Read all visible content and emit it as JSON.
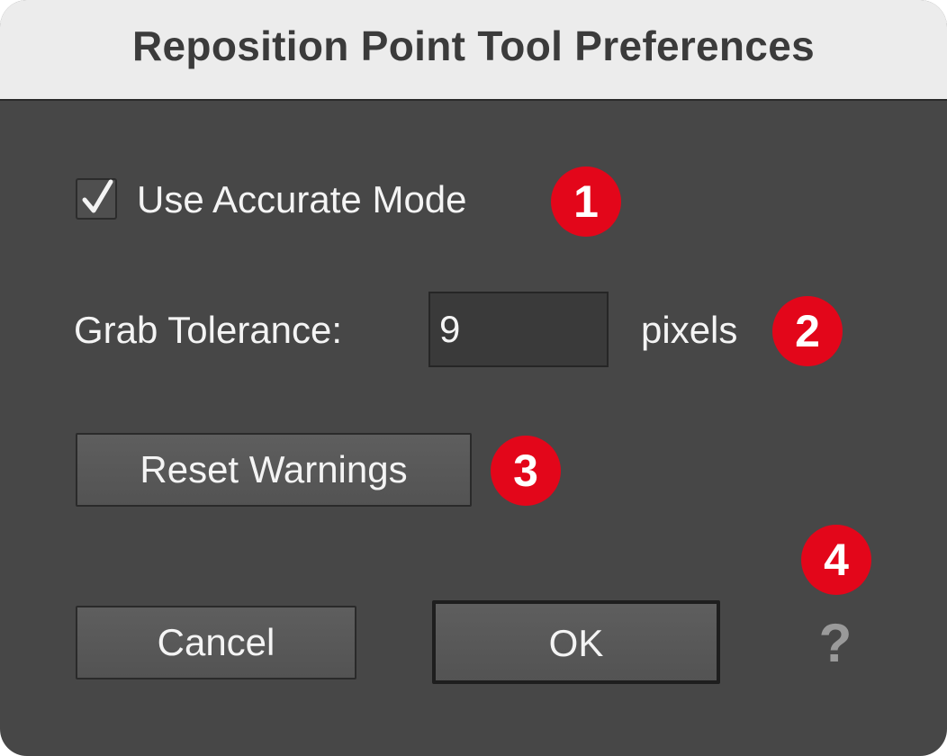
{
  "dialog": {
    "title": "Reposition Point Tool Preferences"
  },
  "options": {
    "accurate_mode_label": "Use Accurate Mode",
    "accurate_mode_checked": true,
    "grab_tolerance_label": "Grab Tolerance:",
    "grab_tolerance_value": "9",
    "grab_tolerance_unit": "pixels",
    "reset_warnings_label": "Reset Warnings"
  },
  "footer": {
    "cancel_label": "Cancel",
    "ok_label": "OK",
    "help_label": "?"
  },
  "callouts": [
    "1",
    "2",
    "3",
    "4"
  ],
  "colors": {
    "callout": "#e3061a",
    "panel": "#474747",
    "titlebar": "#ececec"
  },
  "icons": {
    "checkbox_mark": "checkmark-icon",
    "help": "question-mark-icon"
  }
}
